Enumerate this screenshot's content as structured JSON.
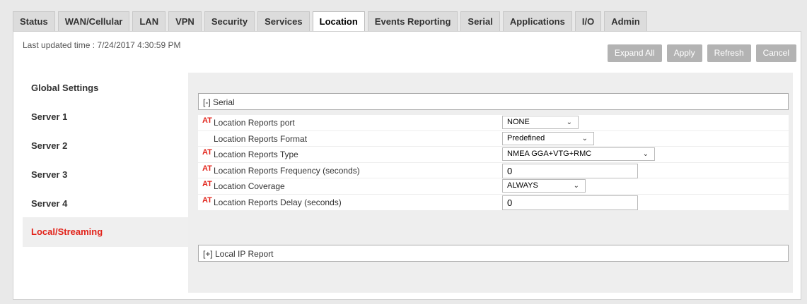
{
  "tabs": [
    {
      "label": "Status"
    },
    {
      "label": "WAN/Cellular"
    },
    {
      "label": "LAN"
    },
    {
      "label": "VPN"
    },
    {
      "label": "Security"
    },
    {
      "label": "Services"
    },
    {
      "label": "Location"
    },
    {
      "label": "Events Reporting"
    },
    {
      "label": "Serial"
    },
    {
      "label": "Applications"
    },
    {
      "label": "I/O"
    },
    {
      "label": "Admin"
    }
  ],
  "header": {
    "last_updated": "Last updated time : 7/24/2017 4:30:59 PM"
  },
  "toolbar": {
    "expand_all": "Expand All",
    "apply": "Apply",
    "refresh": "Refresh",
    "cancel": "Cancel"
  },
  "sidebar": {
    "items": [
      {
        "label": "Global Settings"
      },
      {
        "label": "Server 1"
      },
      {
        "label": "Server 2"
      },
      {
        "label": "Server 3"
      },
      {
        "label": "Server 4"
      },
      {
        "label": "Local/Streaming"
      }
    ]
  },
  "serial_section": {
    "title": "[-] Serial"
  },
  "local_ip_section": {
    "title": "[+] Local IP Report"
  },
  "at_marker": "AT",
  "rows": [
    {
      "label": "Location Reports port",
      "value": "NONE"
    },
    {
      "label": "Location Reports Format",
      "value": "Predefined"
    },
    {
      "label": "Location Reports Type",
      "value": "NMEA GGA+VTG+RMC"
    },
    {
      "label": "Location Reports Frequency (seconds)",
      "value": "0"
    },
    {
      "label": "Location Coverage",
      "value": "ALWAYS"
    },
    {
      "label": "Location Reports Delay (seconds)",
      "value": "0"
    }
  ],
  "colors": {
    "accent": "#e2231a",
    "button": "#b3b3b3"
  }
}
